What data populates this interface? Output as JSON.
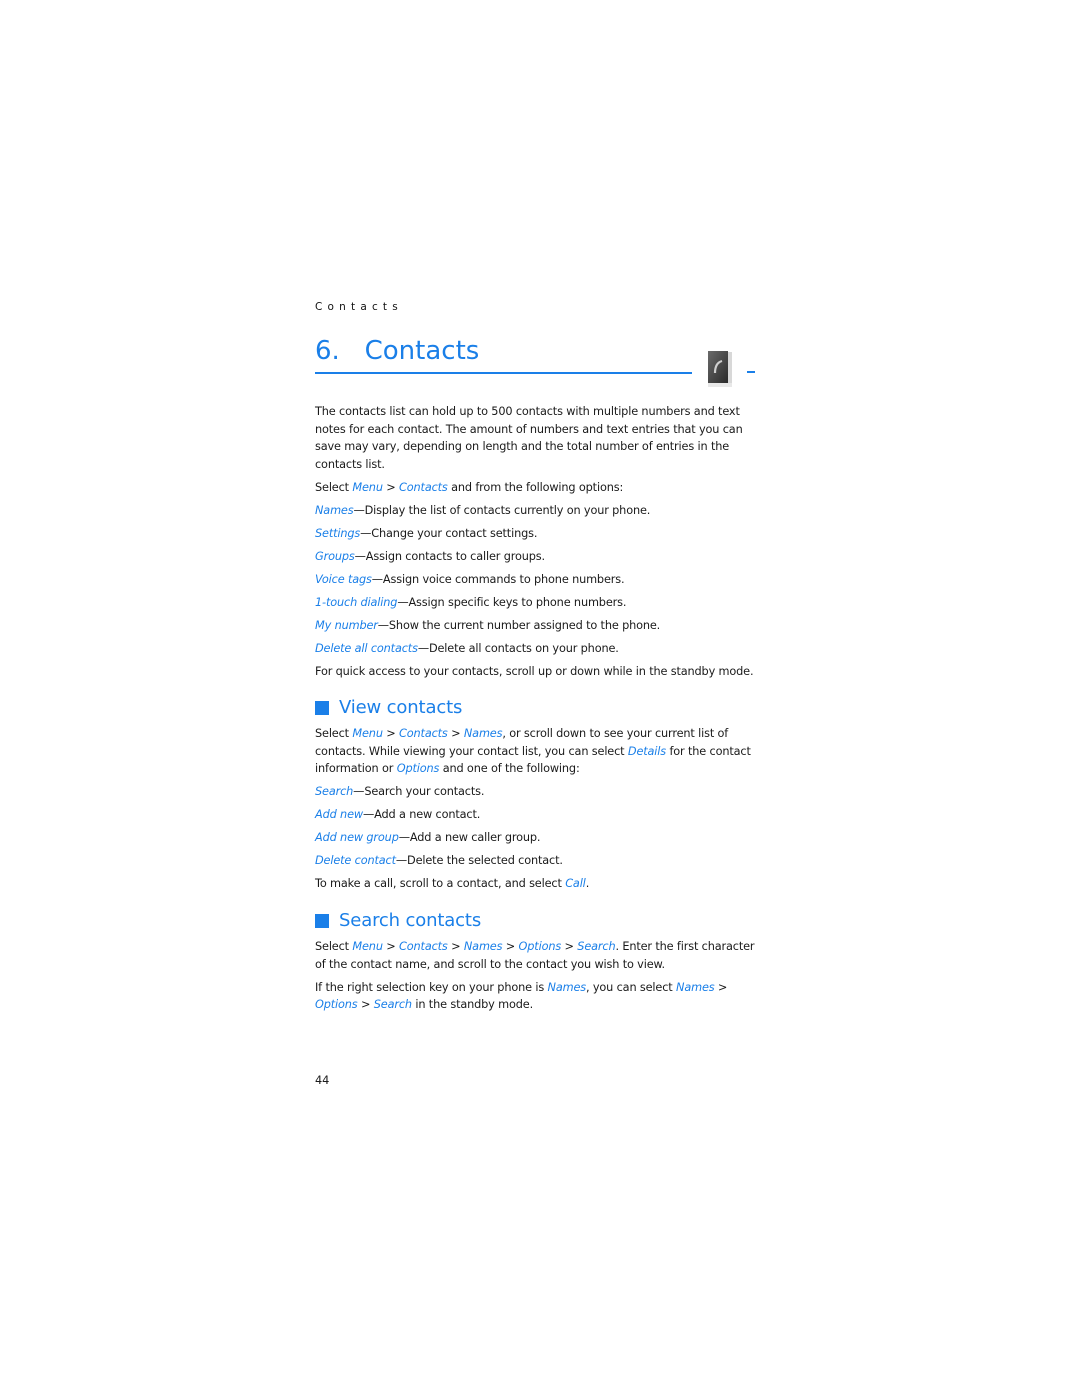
{
  "running_head": "Contacts",
  "chapter": {
    "number": "6.",
    "title": "Contacts",
    "icon": "contacts-book-icon"
  },
  "intro": "The contacts list can hold up to 500 contacts with multiple numbers and text notes for each contact. The amount of numbers and text entries that you can save may vary, depending on length and the total number of entries in the contacts list.",
  "select_line": {
    "prefix": "Select ",
    "menu": "Menu",
    "sep1": " > ",
    "contacts": "Contacts",
    "suffix": " and from the following options:"
  },
  "options": [
    {
      "term": "Names",
      "desc": "—Display the list of contacts currently on your phone."
    },
    {
      "term": "Settings",
      "desc": "—Change your contact settings."
    },
    {
      "term": "Groups",
      "desc": "—Assign contacts to caller groups."
    },
    {
      "term": "Voice tags",
      "desc": "—Assign voice commands to phone numbers."
    },
    {
      "term": "1-touch dialing",
      "desc": "—Assign specific keys to phone numbers."
    },
    {
      "term": "My number",
      "desc": "—Show the current number assigned to the phone."
    },
    {
      "term": "Delete all contacts",
      "desc": "—Delete all contacts on your phone."
    }
  ],
  "quick_access": "For quick access to your contacts, scroll up or down while in the standby mode.",
  "view_contacts": {
    "heading": "View contacts",
    "p1": {
      "t1": "Select ",
      "l1": "Menu",
      "t2": " > ",
      "l2": "Contacts",
      "t3": " > ",
      "l3": "Names",
      "t4": ", or scroll down to see your current list of contacts. While viewing your contact list, you can select ",
      "l4": "Details",
      "t5": " for the contact information or ",
      "l5": "Options",
      "t6": " and one of the following:"
    },
    "options": [
      {
        "term": "Search",
        "desc": "—Search your contacts."
      },
      {
        "term": "Add new",
        "desc": "—Add a new contact."
      },
      {
        "term": "Add new group",
        "desc": "—Add a new caller group."
      },
      {
        "term": "Delete contact",
        "desc": "—Delete the selected contact."
      }
    ],
    "call_line": {
      "text": "To make a call, scroll to a contact, and select ",
      "link": "Call",
      "end": "."
    }
  },
  "search_contacts": {
    "heading": "Search contacts",
    "p1": {
      "t1": "Select ",
      "l1": "Menu",
      "t2": " > ",
      "l2": "Contacts",
      "t3": " > ",
      "l3": "Names",
      "t4": " > ",
      "l4": "Options",
      "t5": " > ",
      "l5": "Search",
      "t6": ". Enter the first character of the contact name, and scroll to the contact you wish to view."
    },
    "p2": {
      "t1": "If the right selection key on your phone is ",
      "l1": "Names",
      "t2": ", you can select ",
      "l2": "Names",
      "t3": " > ",
      "l3": "Options",
      "t4": " > ",
      "l4": "Search",
      "t5": " in the standby mode."
    }
  },
  "page_number": "44"
}
